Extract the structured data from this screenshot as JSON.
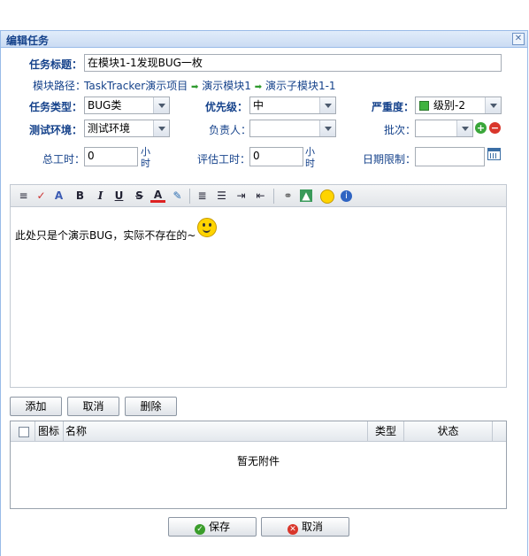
{
  "dialog": {
    "title": "编辑任务",
    "close_glyph": "✕"
  },
  "form": {
    "task_title_label": "任务标题：",
    "task_title_value": "在模块1-1发现BUG一枚",
    "module_path_label": "模块路径：",
    "module_path": [
      "TaskTracker演示项目",
      "演示模块1",
      "演示子模块1-1"
    ],
    "task_type_label": "任务类型：",
    "task_type_value": "BUG类",
    "priority_label": "优先级：",
    "priority_value": "中",
    "severity_label": "严重度：",
    "severity_value": "级别-2",
    "test_env_label": "测试环境：",
    "test_env_value": "测试环境",
    "owner_label": "负责人：",
    "owner_value": "",
    "batch_label": "批次：",
    "batch_value": "",
    "total_hours_label": "总工时：",
    "total_hours_value": "0",
    "estimate_hours_label": "评估工时：",
    "estimate_hours_value": "0",
    "hours_unit_1": "小",
    "hours_unit_2": "时",
    "date_limit_label": "日期限制：",
    "date_limit_value": ""
  },
  "editor": {
    "content": "此处只是个演示BUG，实际不存在的~",
    "toolbar": [
      "format-icon",
      "spellcheck-icon",
      "font-icon",
      "bold",
      "italic",
      "underline",
      "strikethrough",
      "font-color",
      "highlight",
      "align-icon",
      "list-icon",
      "indent-icon",
      "outdent-icon",
      "link-icon",
      "image-icon",
      "emoticon-icon",
      "info-icon"
    ],
    "bold_glyph": "B",
    "italic_glyph": "I",
    "underline_glyph": "U",
    "strike_glyph": "S",
    "color_glyph": "A"
  },
  "attachments": {
    "add_label": "添加",
    "cancel_label": "取消",
    "delete_label": "删除",
    "columns": {
      "icon": "图标",
      "name": "名称",
      "type": "类型",
      "status": "状态"
    },
    "empty_text": "暂无附件"
  },
  "footer": {
    "save_label": "保存",
    "cancel_label": "取消"
  },
  "colors": {
    "title_bar": "#cbdcf3",
    "label": "#15428b",
    "border": "#99bbe8",
    "save_icon": "#3a9d2b",
    "cancel_icon": "#d9362b"
  }
}
